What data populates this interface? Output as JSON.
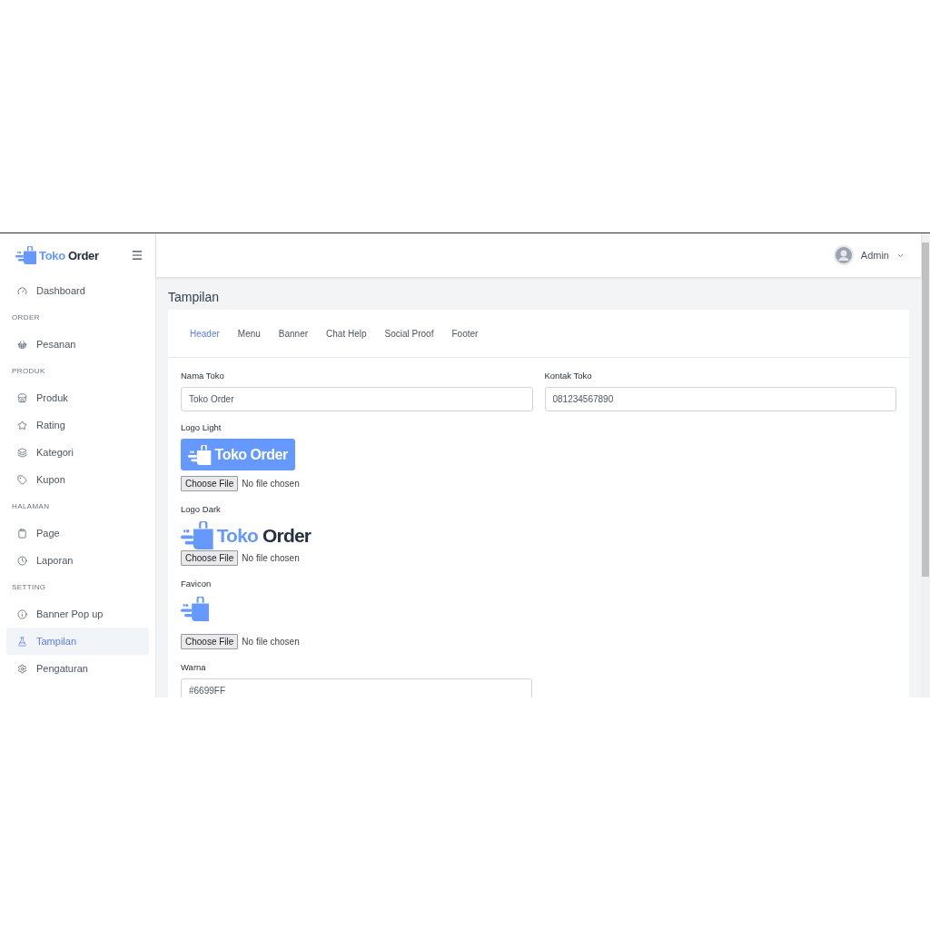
{
  "brand": {
    "word_1": "Toko",
    "word_2": "Order"
  },
  "sidebar": {
    "items": [
      {
        "kind": "link",
        "label": "Dashboard",
        "selected": false
      },
      {
        "kind": "heading",
        "label": "ORDER"
      },
      {
        "kind": "link",
        "label": "Pesanan",
        "selected": false
      },
      {
        "kind": "heading",
        "label": "PRODUK"
      },
      {
        "kind": "link",
        "label": "Produk",
        "selected": false
      },
      {
        "kind": "link",
        "label": "Rating",
        "selected": false
      },
      {
        "kind": "link",
        "label": "Kategori",
        "selected": false
      },
      {
        "kind": "link",
        "label": "Kupon",
        "selected": false
      },
      {
        "kind": "heading",
        "label": "HALAMAN"
      },
      {
        "kind": "link",
        "label": "Page",
        "selected": false
      },
      {
        "kind": "link",
        "label": "Laporan",
        "selected": false
      },
      {
        "kind": "heading",
        "label": "SETTING"
      },
      {
        "kind": "link",
        "label": "Banner Pop up",
        "selected": false
      },
      {
        "kind": "link",
        "label": "Tampilan",
        "selected": true
      },
      {
        "kind": "link",
        "label": "Pengaturan",
        "selected": false
      }
    ]
  },
  "header": {
    "user": "Admin"
  },
  "page_title": "Tampilan",
  "tabs": [
    {
      "label": "Header",
      "selected": true
    },
    {
      "label": "Menu",
      "selected": false
    },
    {
      "label": "Banner",
      "selected": false
    },
    {
      "label": "Chat Help",
      "selected": false
    },
    {
      "label": "Social Proof",
      "selected": false
    },
    {
      "label": "Footer",
      "selected": false
    }
  ],
  "form": {
    "fields_row": [
      {
        "label": "Nama Toko",
        "value": "Toko Order"
      },
      {
        "label": "Kontak Toko",
        "value": "081234567890"
      }
    ],
    "images": [
      {
        "kind": "logo_light",
        "label": "Logo Light",
        "word_1": "Toko",
        "word_2": "Order",
        "file_button": "Choose File",
        "file_status": "No file chosen"
      },
      {
        "kind": "logo_dark",
        "label": "Logo Dark",
        "word_1": "Toko",
        "word_2": "Order",
        "file_button": "Choose File",
        "file_status": "No file chosen"
      },
      {
        "kind": "favicon",
        "label": "Favicon",
        "file_button": "Choose File",
        "file_status": "No file chosen"
      }
    ],
    "color_field": {
      "label": "Warna",
      "value": "#6699FF"
    }
  }
}
